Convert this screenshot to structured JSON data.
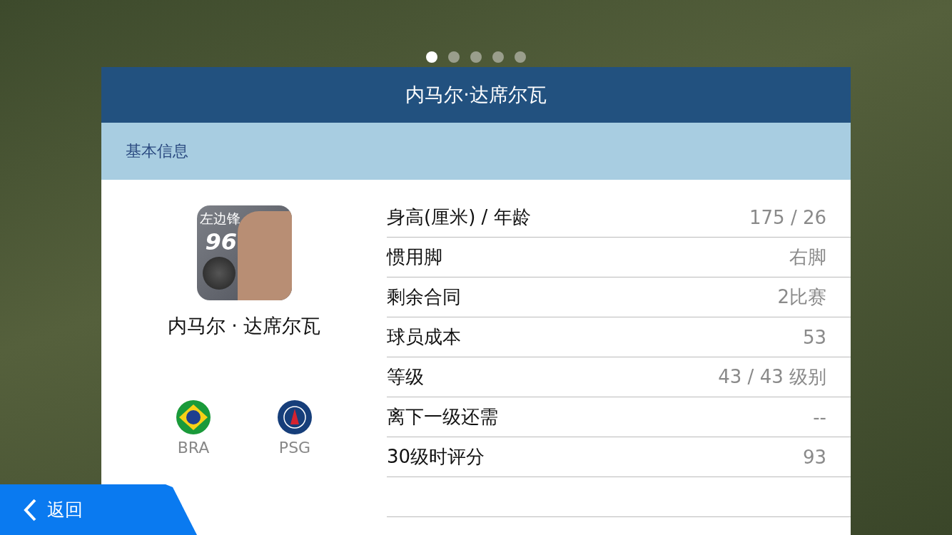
{
  "pager": [
    {
      "selected": true
    },
    {
      "selected": false
    },
    {
      "selected": false
    },
    {
      "selected": false
    },
    {
      "selected": false
    }
  ],
  "header": {
    "title": "内马尔·达席尔瓦"
  },
  "section": {
    "title": "基本信息"
  },
  "player": {
    "position": "左边锋",
    "rating": "96",
    "name": "内马尔 · 达席尔瓦",
    "nation": "BRA",
    "club": "PSG"
  },
  "stats": [
    {
      "label": "身高(厘米) / 年龄",
      "value": "175 / 26"
    },
    {
      "label": "惯用脚",
      "value": "右脚"
    },
    {
      "label": "剩余合同",
      "value": "2比赛"
    },
    {
      "label": "球员成本",
      "value": "53"
    },
    {
      "label": "等级",
      "value": "43 / 43 级别"
    },
    {
      "label": "离下一级还需",
      "value": "--"
    },
    {
      "label": "30级时评分",
      "value": "93"
    }
  ],
  "back_button": {
    "label": "返回"
  }
}
